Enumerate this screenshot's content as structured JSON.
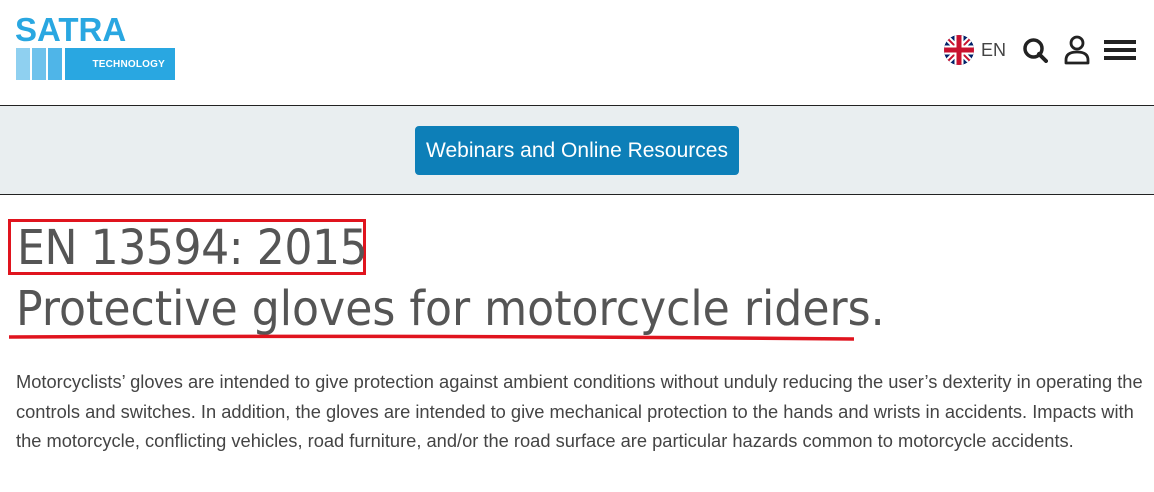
{
  "header": {
    "logo_word": "SATRA",
    "logo_sub": "TECHNOLOGY",
    "language": "EN",
    "icons": [
      "uk-flag-icon",
      "search-icon",
      "user-icon",
      "menu-icon"
    ]
  },
  "banner": {
    "button_label": "Webinars and Online Resources"
  },
  "main": {
    "standard_code": "EN 13594: 2015",
    "standard_title": "Protective gloves for motorcycle riders.",
    "description": "Motorcyclists’ gloves are intended to give protection against ambient conditions without unduly reducing the user’s dexterity in operating the controls and switches. In addition, the gloves are intended to give mechanical protection to the hands and wrists in accidents. Impacts with the motorcycle, conflicting vehicles, road furniture, and/or the road surface are particular hazards common to motorcycle accidents."
  },
  "colors": {
    "brand_blue": "#29a7e1",
    "button_blue": "#0d7fb8",
    "annotation_red": "#e0141e",
    "banner_bg": "#e9eef0"
  }
}
